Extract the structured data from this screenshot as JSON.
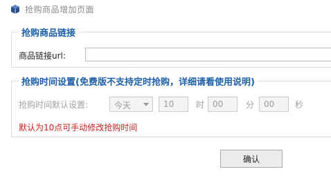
{
  "window": {
    "title": "抢购商品增加页面",
    "icon": "app-icon"
  },
  "link_group": {
    "legend": "抢购商品链接",
    "url_label": "商品链接url:",
    "url_value": ""
  },
  "time_group": {
    "legend": "抢购时间设置(免费版不支持定时抢购，详细请看使用说明)",
    "default_label": "抢购时间默认设置:",
    "day_select": "今天",
    "hour_value": "10",
    "hour_unit": "时",
    "minute_value": "00",
    "minute_unit": "分",
    "second_value": "00",
    "second_unit": "秒",
    "note": "默认为10点可手动修改抢购时间"
  },
  "actions": {
    "confirm_label": "确认"
  }
}
